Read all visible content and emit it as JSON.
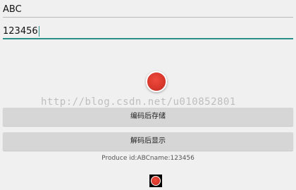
{
  "inputs": {
    "name_value": "ABC",
    "id_value": "123456"
  },
  "watermark": "http://blog.csdn.net/u010852801",
  "buttons": {
    "encode_label": "编码后存储",
    "decode_label": "解码后显示"
  },
  "result_text": "Produce id:ABCname:123456",
  "colors": {
    "accent": "#2a8f86",
    "record_red": "#d7372b",
    "button_bg": "#d6d6d6",
    "background": "#f0f0f0"
  }
}
